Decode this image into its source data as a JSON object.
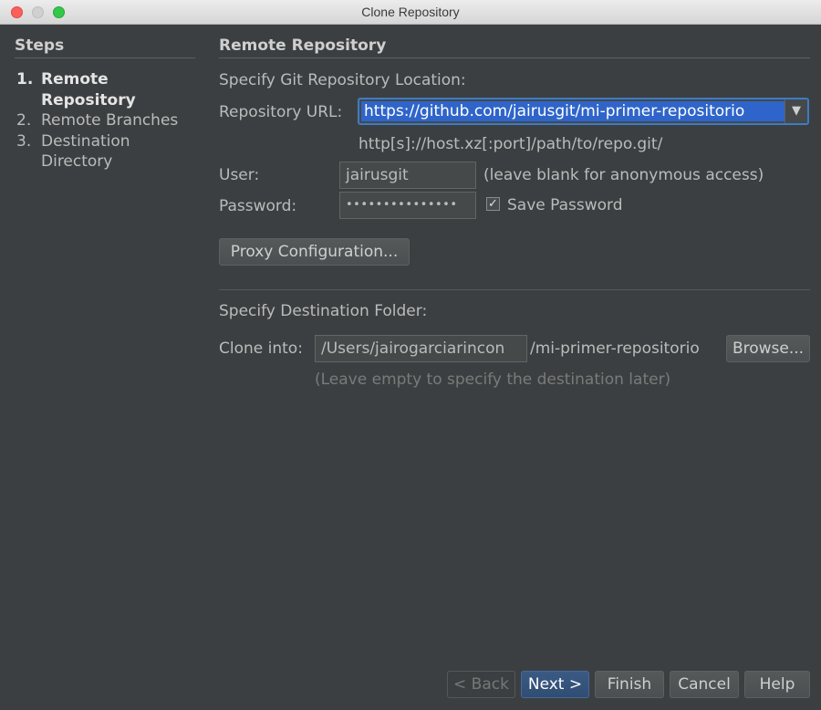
{
  "window": {
    "title": "Clone Repository"
  },
  "steps": {
    "header": "Steps",
    "items": [
      {
        "num": "1.",
        "label": "Remote Repository"
      },
      {
        "num": "2.",
        "label": "Remote Branches"
      },
      {
        "num": "3.",
        "label": "Destination Directory"
      }
    ]
  },
  "panel": {
    "header": "Remote Repository",
    "location_label": "Specify Git Repository Location:",
    "url_label": "Repository URL:",
    "url_value": "https://github.com/jairusgit/mi-primer-repositorio",
    "url_hint": "http[s]://host.xz[:port]/path/to/repo.git/",
    "user_label": "User:",
    "user_value": "jairusgit",
    "user_hint": "(leave blank for anonymous access)",
    "password_label": "Password:",
    "password_value": "•••••••••••••••",
    "save_password_label": "Save Password",
    "save_password_checked": true,
    "proxy_button": "Proxy Configuration...",
    "destination_label": "Specify Destination Folder:",
    "clone_into_label": "Clone into:",
    "clone_into_value": "/Users/jairogarciarincon",
    "clone_into_suffix": "/mi-primer-repositorio",
    "browse_button": "Browse...",
    "destination_hint": "(Leave empty to specify the destination later)"
  },
  "footer": {
    "back": "< Back",
    "next": "Next >",
    "finish": "Finish",
    "cancel": "Cancel",
    "help": "Help"
  }
}
